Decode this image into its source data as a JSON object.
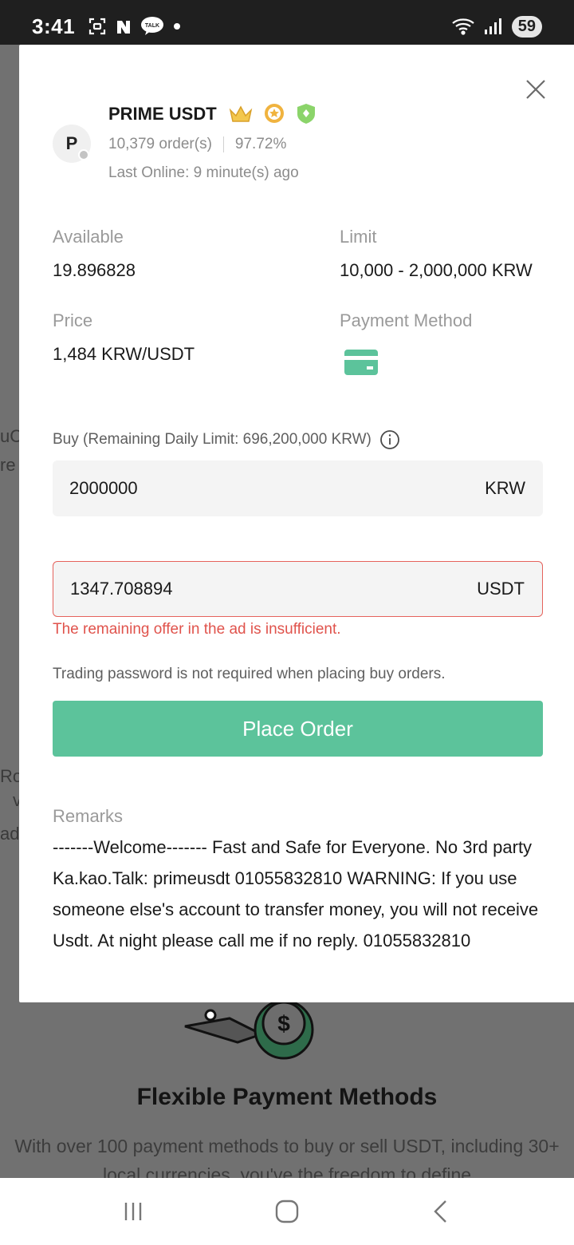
{
  "status_bar": {
    "time": "3:41",
    "notification_icons": [
      "screenshot-icon",
      "naver-icon",
      "kakaotalk-icon",
      "dot-icon"
    ],
    "right_icons": [
      "wifi-icon",
      "signal-icon"
    ],
    "battery": "59"
  },
  "background": {
    "fragments": [
      "uC",
      "re",
      "Ro",
      "v",
      "ad"
    ],
    "title": "Flexible Payment Methods",
    "description": "With over 100 payment methods to buy or sell USDT, including 30+ local currencies, you've the freedom to define"
  },
  "merchant": {
    "avatar_letter": "P",
    "name": "PRIME USDT",
    "badges": [
      "crown-badge-icon",
      "gold-medal-badge-icon",
      "verified-shield-badge-icon"
    ],
    "orders": "10,379 order(s)",
    "completion_rate": "97.72%",
    "last_online": "Last Online: 9 minute(s) ago"
  },
  "info": {
    "available_label": "Available",
    "available_value": "19.896828",
    "limit_label": "Limit",
    "limit_value": "10,000 - 2,000,000 KRW",
    "price_label": "Price",
    "price_value": "1,484 KRW/USDT",
    "payment_label": "Payment Method",
    "payment_icon": "bank-card-icon"
  },
  "order_form": {
    "buy_label": "Buy (Remaining Daily Limit: 696,200,000 KRW)",
    "krw_value": "2000000",
    "krw_unit": "KRW",
    "usdt_value": "1347.708894",
    "usdt_unit": "USDT",
    "error": "The remaining offer in the ad is insufficient.",
    "hint": "Trading password is not required when placing buy orders.",
    "button": "Place Order"
  },
  "remarks": {
    "label": "Remarks",
    "text": "-------Welcome------- Fast and Safe for Everyone. No 3rd party Ka.kao.Talk: primeusdt 01055832810 WARNING: If you use someone else's account to transfer money, you will not receive Usdt. At night please call me if no reply. 01055832810"
  },
  "colors": {
    "accent": "#5cc39b",
    "error": "#e0534c",
    "muted": "#9a9a9a"
  }
}
